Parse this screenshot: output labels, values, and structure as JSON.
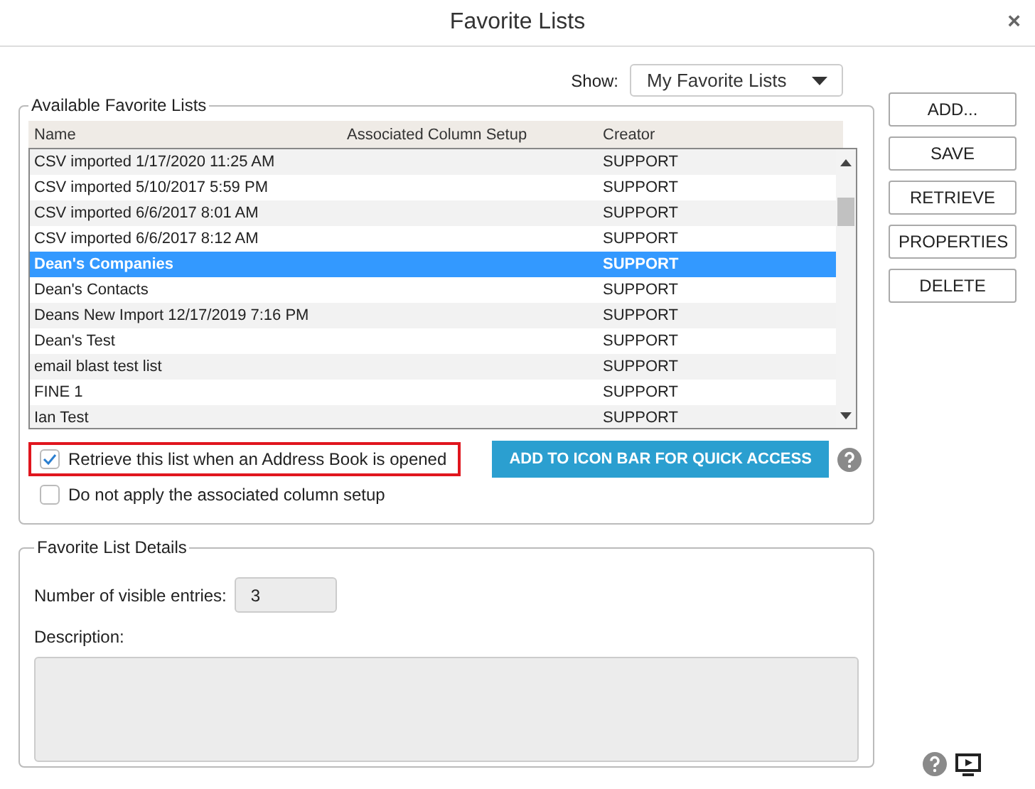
{
  "window": {
    "title": "Favorite Lists",
    "close": "×"
  },
  "show": {
    "label": "Show:",
    "value": "My Favorite Lists"
  },
  "available": {
    "legend": "Available Favorite Lists",
    "columns": [
      "Name",
      "Associated Column Setup",
      "Creator"
    ],
    "rows": [
      {
        "name": "CSV imported 1/17/2020 11:25 AM",
        "creator": "SUPPORT",
        "selected": false
      },
      {
        "name": "CSV imported 5/10/2017 5:59 PM",
        "creator": "SUPPORT",
        "selected": false
      },
      {
        "name": "CSV imported 6/6/2017 8:01 AM",
        "creator": "SUPPORT",
        "selected": false
      },
      {
        "name": "CSV imported 6/6/2017 8:12 AM",
        "creator": "SUPPORT",
        "selected": false
      },
      {
        "name": "Dean's Companies",
        "creator": "SUPPORT",
        "selected": true
      },
      {
        "name": "Dean's Contacts",
        "creator": "SUPPORT",
        "selected": false
      },
      {
        "name": "Deans New Import 12/17/2019 7:16 PM",
        "creator": "SUPPORT",
        "selected": false
      },
      {
        "name": "Dean's Test",
        "creator": "SUPPORT",
        "selected": false
      },
      {
        "name": "email blast test list",
        "creator": "SUPPORT",
        "selected": false
      },
      {
        "name": "FINE 1",
        "creator": "SUPPORT",
        "selected": false
      },
      {
        "name": "Ian Test",
        "creator": "SUPPORT",
        "selected": false
      }
    ],
    "options": [
      {
        "label": "Retrieve this list when an Address Book is opened",
        "checked": true,
        "highlighted": true
      },
      {
        "label": "Do not apply the associated column setup",
        "checked": false,
        "highlighted": false
      }
    ],
    "quick_access_button": "ADD TO ICON BAR FOR QUICK ACCESS"
  },
  "buttons": [
    "ADD...",
    "SAVE",
    "RETRIEVE",
    "PROPERTIES",
    "DELETE"
  ],
  "details": {
    "legend": "Favorite List Details",
    "entries_label": "Number of visible entries:",
    "entries_value": "3",
    "description_label": "Description:"
  }
}
